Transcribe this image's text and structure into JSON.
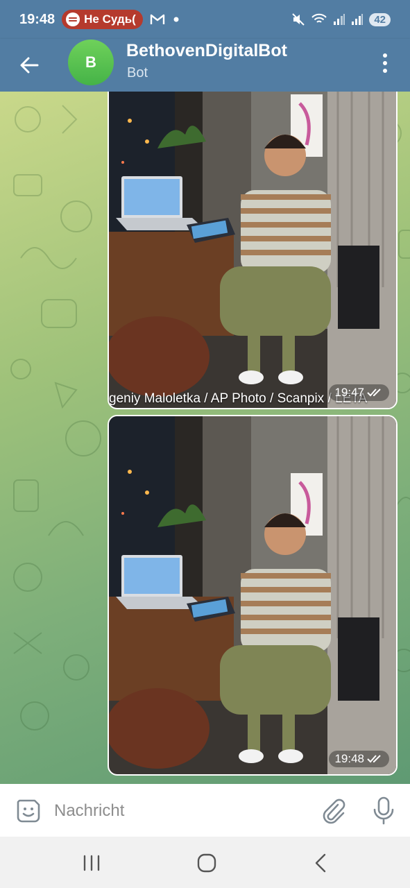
{
  "status_bar": {
    "time": "19:48",
    "media_text": "Не Судь(",
    "battery": "42"
  },
  "header": {
    "avatar_letter": "B",
    "title": "BethovenDigitalBot",
    "subtitle": "Bot"
  },
  "messages": [
    {
      "caption": "geniy Maloletka / AP Photo / Scanpix / LETA",
      "time": "19:47"
    },
    {
      "time": "19:48"
    }
  ],
  "input": {
    "placeholder": "Nachricht"
  },
  "colors": {
    "header": "#527da3",
    "avatar": "#4fbf4b",
    "status_pill": "#b53a2d"
  }
}
